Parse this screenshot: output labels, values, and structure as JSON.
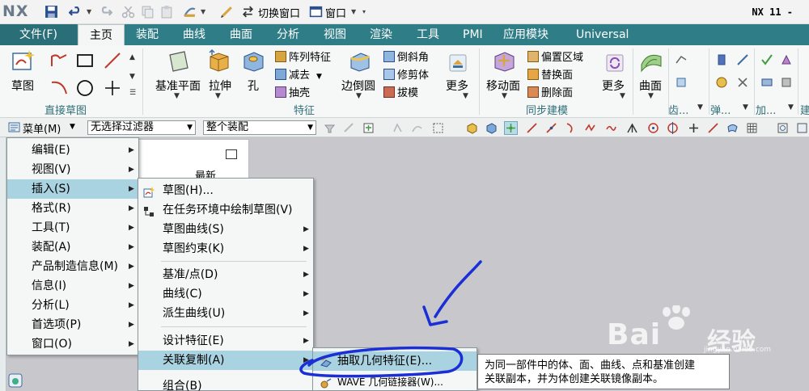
{
  "titlebar": {
    "logo": "NX",
    "switch_window": "切换窗口",
    "window": "窗口",
    "version": "NX 11 -"
  },
  "tabs": [
    {
      "label": "文件(F)"
    },
    {
      "label": "主页"
    },
    {
      "label": "装配"
    },
    {
      "label": "曲线"
    },
    {
      "label": "曲面"
    },
    {
      "label": "分析"
    },
    {
      "label": "视图"
    },
    {
      "label": "渲染"
    },
    {
      "label": "工具"
    },
    {
      "label": "PMI"
    },
    {
      "label": "应用模块"
    },
    {
      "label": "Universal"
    }
  ],
  "ribbon": {
    "sketch": "草图",
    "direct_sketch_group": "直接草图",
    "datum_plane": "基准平面",
    "extrude": "拉伸",
    "hole": "孔",
    "pattern_feature": "阵列特征",
    "subtract": "减去",
    "shell": "抽壳",
    "edge_blend": "边倒圆",
    "chamfer": "倒斜角",
    "trim_body": "修剪体",
    "draft": "拔模",
    "more": "更多",
    "feature_group": "特征",
    "move_face": "移动面",
    "offset_region": "偏置区域",
    "replace_face": "替换面",
    "delete_face": "删除面",
    "sync_group": "同步建模",
    "surface": "曲面",
    "gear_group": "齿...",
    "spring_group": "弹...",
    "add_group": "加...",
    "build_group": "建"
  },
  "selbar": {
    "menu": "菜单(M)",
    "filter": "无选择过滤器",
    "scope": "整个装配"
  },
  "navpanel": {
    "latest": "最新"
  },
  "menu_main": [
    {
      "label": "编辑(E)"
    },
    {
      "label": "视图(V)"
    },
    {
      "label": "插入(S)"
    },
    {
      "label": "格式(R)"
    },
    {
      "label": "工具(T)"
    },
    {
      "label": "装配(A)"
    },
    {
      "label": "产品制造信息(M)"
    },
    {
      "label": "信息(I)"
    },
    {
      "label": "分析(L)"
    },
    {
      "label": "首选项(P)"
    },
    {
      "label": "窗口(O)"
    }
  ],
  "menu_insert": [
    {
      "label": "草图(H)..."
    },
    {
      "label": "在任务环境中绘制草图(V)"
    },
    {
      "label": "草图曲线(S)"
    },
    {
      "label": "草图约束(K)"
    },
    {
      "label": "基准/点(D)"
    },
    {
      "label": "曲线(C)"
    },
    {
      "label": "派生曲线(U)"
    },
    {
      "label": "设计特征(E)"
    },
    {
      "label": "关联复制(A)"
    },
    {
      "label": "组合(B)"
    }
  ],
  "menu_assoc": [
    {
      "label": "抽取几何特征(E)..."
    },
    {
      "label": "WAVE 几何链接器(W)..."
    }
  ],
  "tooltip": {
    "line1": "为同一部件中的体、面、曲线、点和基准创建",
    "line2": "关联副本，并为体创建关联镜像副本。"
  },
  "watermark": {
    "text1": "Bai",
    "text2": "经验",
    "sub": "jingyan.baidu.com"
  },
  "colors": {
    "tab_bar": "#2f7d86",
    "highlight": "#a9d3e0",
    "annotation": "#1a2fd6"
  }
}
